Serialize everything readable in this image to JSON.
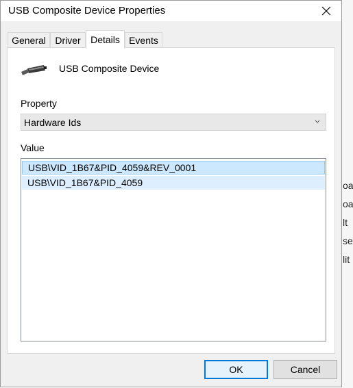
{
  "dialog": {
    "title": "USB Composite Device Properties",
    "close_icon": "close-icon"
  },
  "tabs": [
    {
      "label": "General",
      "active": false
    },
    {
      "label": "Driver",
      "active": false
    },
    {
      "label": "Details",
      "active": true
    },
    {
      "label": "Events",
      "active": false
    }
  ],
  "device": {
    "name": "USB Composite Device",
    "icon": "usb-plug-icon"
  },
  "property": {
    "label": "Property",
    "selected": "Hardware Ids",
    "arrow_icon": "chevron-down-icon"
  },
  "value": {
    "label": "Value",
    "items": [
      "USB\\VID_1B67&PID_4059&REV_0001",
      "USB\\VID_1B67&PID_4059"
    ]
  },
  "buttons": {
    "ok": "OK",
    "cancel": "Cancel"
  },
  "background_fragments": [
    "oa",
    "oa",
    "lt",
    "se",
    "lit"
  ],
  "colors": {
    "accent": "#0078d7",
    "selection": "#cce8ff",
    "selection_border": "#99c9ef"
  }
}
